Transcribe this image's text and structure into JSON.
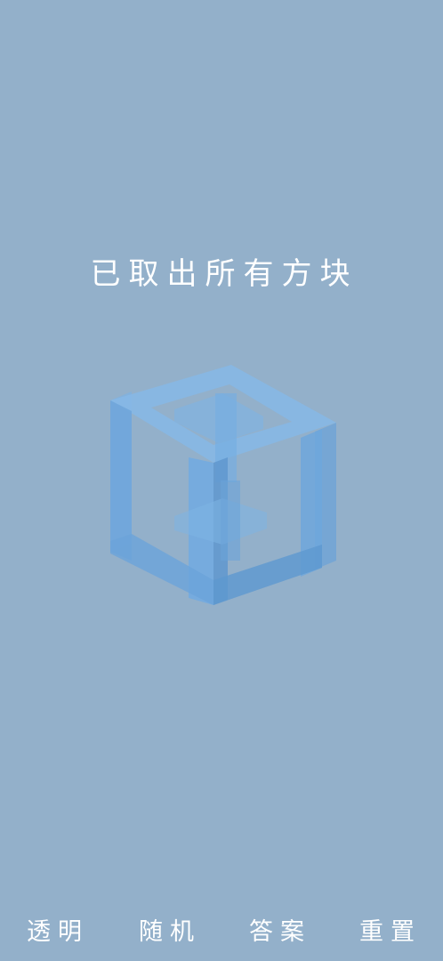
{
  "status": {
    "message": "已取出所有方块"
  },
  "puzzle": {
    "shape": "cube-frame",
    "color": "#6fa8dc"
  },
  "toolbar": {
    "transparent_label": "透明",
    "random_label": "随机",
    "answer_label": "答案",
    "reset_label": "重置"
  },
  "colors": {
    "background": "#93b0ca",
    "text": "#ffffff"
  }
}
